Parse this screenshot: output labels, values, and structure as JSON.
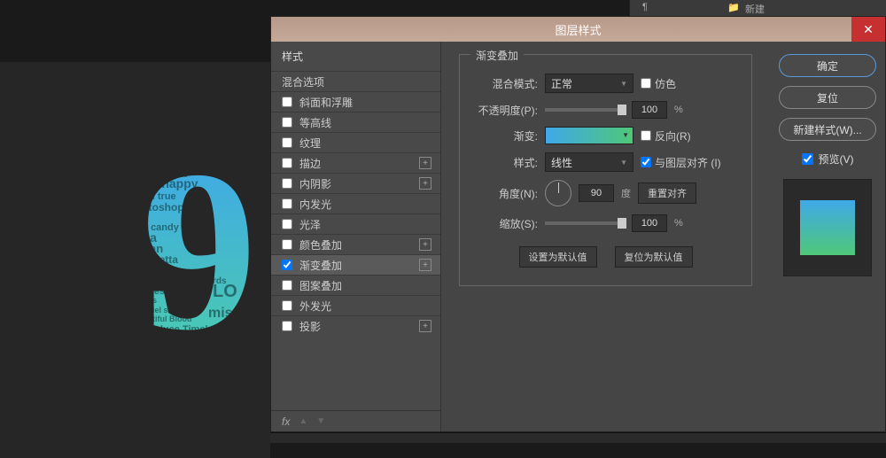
{
  "top_panel": {
    "type_glyph": "¶",
    "folder_glyph": "📁",
    "folder_label": "新建"
  },
  "dialog": {
    "title": "图层样式",
    "close": "✕",
    "left": {
      "header": "样式",
      "blend_options": "混合选项",
      "effects": [
        {
          "label": "斜面和浮雕",
          "checked": false,
          "plus": false
        },
        {
          "label": "等高线",
          "checked": false,
          "plus": false
        },
        {
          "label": "纹理",
          "checked": false,
          "plus": false
        },
        {
          "label": "描边",
          "checked": false,
          "plus": true
        },
        {
          "label": "内阴影",
          "checked": false,
          "plus": true
        },
        {
          "label": "内发光",
          "checked": false,
          "plus": false
        },
        {
          "label": "光泽",
          "checked": false,
          "plus": false
        },
        {
          "label": "颜色叠加",
          "checked": false,
          "plus": true
        },
        {
          "label": "渐变叠加",
          "checked": true,
          "plus": true
        },
        {
          "label": "图案叠加",
          "checked": false,
          "plus": false
        },
        {
          "label": "外发光",
          "checked": false,
          "plus": false
        },
        {
          "label": "投影",
          "checked": false,
          "plus": true
        }
      ],
      "footer_fx": "fx"
    },
    "center": {
      "legend": "渐变叠加",
      "blend_mode_label": "混合模式:",
      "blend_mode_value": "正常",
      "dither_label": "仿色",
      "opacity_label": "不透明度(P):",
      "opacity_value": "100",
      "pct": "%",
      "gradient_label": "渐变:",
      "reverse_label": "反向(R)",
      "style_label": "样式:",
      "style_value": "线性",
      "align_label": "与图层对齐 (I)",
      "angle_label": "角度(N):",
      "angle_value": "90",
      "degree": "度",
      "reset_align": "重置对齐",
      "scale_label": "缩放(S):",
      "scale_value": "100",
      "set_default": "设置为默认值",
      "reset_default": "复位为默认值"
    },
    "right": {
      "ok": "确定",
      "cancel": "复位",
      "new_style": "新建样式(W)...",
      "preview": "预览(V)"
    }
  }
}
